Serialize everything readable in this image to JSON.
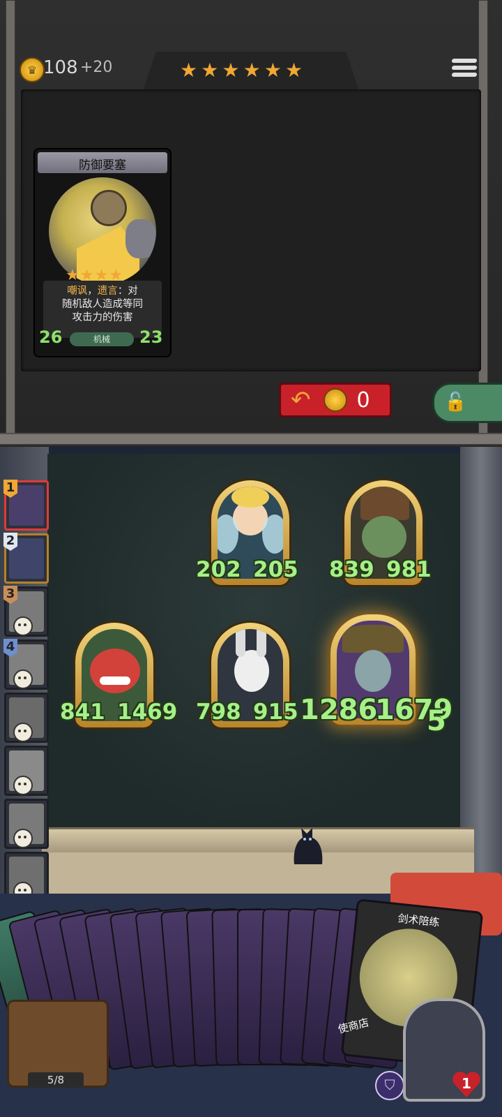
{
  "header": {
    "gold_amount": "108",
    "gold_income": "+20",
    "tier_stars": 6
  },
  "shop_card": {
    "name": "防御要塞",
    "stars": 4,
    "desc_kw1": "嘲讽",
    "desc_sep1": "，",
    "desc_kw2": "遗言",
    "desc_rest1": "：对",
    "desc_line2": "随机敌人造成等同",
    "desc_line3": "攻击力的伤害",
    "attack": "26",
    "health": "23",
    "tribe": "机械"
  },
  "refresh": {
    "cost": "0"
  },
  "board_minions": [
    {
      "attack": "202",
      "health": "205"
    },
    {
      "attack": "839",
      "health": "981"
    },
    {
      "attack": "841",
      "health": "1469"
    },
    {
      "attack": "798",
      "health": "915"
    },
    {
      "attack": "1286",
      "health": "1679"
    }
  ],
  "floating_number": "5",
  "opponents": [
    {
      "rank": "1",
      "eliminated": false
    },
    {
      "rank": "2",
      "eliminated": false
    },
    {
      "rank": "3",
      "eliminated": true
    },
    {
      "rank": "4",
      "eliminated": true
    },
    {
      "rank": "",
      "eliminated": true
    },
    {
      "rank": "",
      "eliminated": true
    },
    {
      "rank": "",
      "eliminated": true
    },
    {
      "rank": "",
      "eliminated": true
    }
  ],
  "hand": {
    "count": "5/8",
    "featured_card_title": "剑术陪练",
    "featured_card_label": "使商店"
  },
  "hero": {
    "health": "1"
  },
  "colors": {
    "gold": "#f0a734",
    "stat_green": "#a5f088",
    "refresh_red": "#c8212a"
  }
}
